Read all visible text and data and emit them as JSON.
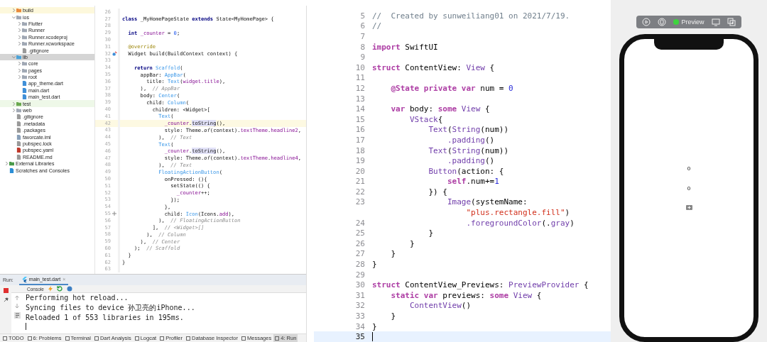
{
  "project_tree": [
    {
      "name": "build",
      "kind": "excluded",
      "expanded": false,
      "selected": false
    },
    {
      "name": "ios",
      "kind": "folder",
      "expanded": true,
      "selected": false,
      "children": [
        {
          "name": "Flutter",
          "kind": "folder",
          "expanded": false,
          "selected": false
        },
        {
          "name": "Runner",
          "kind": "folder",
          "expanded": false,
          "selected": false
        },
        {
          "name": "Runner.xcodeproj",
          "kind": "folder",
          "expanded": false,
          "selected": false
        },
        {
          "name": "Runner.xcworkspace",
          "kind": "folder",
          "expanded": false,
          "selected": false
        },
        {
          "name": ".gitignore",
          "kind": "file",
          "selected": false
        }
      ]
    },
    {
      "name": "lib",
      "kind": "source",
      "expanded": true,
      "selected": true,
      "children": [
        {
          "name": "core",
          "kind": "package",
          "expanded": false,
          "selected": false
        },
        {
          "name": "pages",
          "kind": "package",
          "expanded": false,
          "selected": false
        },
        {
          "name": "root",
          "kind": "package",
          "expanded": false,
          "selected": false
        },
        {
          "name": "app_theme.dart",
          "kind": "dart",
          "selected": false
        },
        {
          "name": "main.dart",
          "kind": "dart",
          "selected": false
        },
        {
          "name": "main_test.dart",
          "kind": "dart",
          "selected": false
        }
      ]
    },
    {
      "name": "test",
      "kind": "test",
      "expanded": false,
      "selected": false
    },
    {
      "name": "web",
      "kind": "folder",
      "expanded": false,
      "selected": false
    },
    {
      "name": ".gitignore",
      "kind": "file",
      "selected": false
    },
    {
      "name": ".metadata",
      "kind": "file",
      "selected": false
    },
    {
      "name": ".packages",
      "kind": "file",
      "selected": false
    },
    {
      "name": "favorcate.iml",
      "kind": "iml",
      "selected": false
    },
    {
      "name": "pubspec.lock",
      "kind": "file",
      "selected": false
    },
    {
      "name": "pubspec.yaml",
      "kind": "yaml",
      "selected": false
    },
    {
      "name": "README.md",
      "kind": "file",
      "selected": false
    },
    {
      "name": "External Libraries",
      "kind": "libraries",
      "expanded": false,
      "selected": false
    },
    {
      "name": "Scratches and Consoles",
      "kind": "scratches",
      "selected": false
    }
  ],
  "dart_editor": {
    "lines": [
      {
        "number": "26"
      },
      {
        "number": "27",
        "tokens": [
          {
            "text": "class ",
            "kind": "k"
          },
          {
            "text": "_MyHomePageState ",
            "kind": "p"
          },
          {
            "text": "extends ",
            "kind": "k"
          },
          {
            "text": "State<MyHomePage> {",
            "kind": "p"
          }
        ]
      },
      {
        "number": "28"
      },
      {
        "number": "29",
        "tokens": [
          {
            "text": "  int ",
            "kind": "k"
          },
          {
            "text": "_counter",
            "kind": "f"
          },
          {
            "text": " = ",
            "kind": "p"
          },
          {
            "text": "0",
            "kind": "n"
          },
          {
            "text": ";",
            "kind": "p"
          }
        ]
      },
      {
        "number": "30"
      },
      {
        "number": "31",
        "tokens": [
          {
            "text": "  @override",
            "kind": "a"
          }
        ]
      },
      {
        "number": "32",
        "kind": "override",
        "tokens": [
          {
            "text": "  Widget build(BuildContext context) {",
            "kind": "p"
          }
        ]
      },
      {
        "number": "33"
      },
      {
        "number": "34",
        "tokens": [
          {
            "text": "    return ",
            "kind": "k"
          },
          {
            "text": "Scaffold",
            "kind": "c"
          },
          {
            "text": "(",
            "kind": "p"
          }
        ]
      },
      {
        "number": "35",
        "tokens": [
          {
            "text": "      appBar: ",
            "kind": "p"
          },
          {
            "text": "AppBar",
            "kind": "c"
          },
          {
            "text": "(",
            "kind": "p"
          }
        ]
      },
      {
        "number": "36",
        "tokens": [
          {
            "text": "        title: ",
            "kind": "p"
          },
          {
            "text": "Text",
            "kind": "c"
          },
          {
            "text": "(",
            "kind": "p"
          },
          {
            "text": "widget.title",
            "kind": "f"
          },
          {
            "text": "),",
            "kind": "p"
          }
        ]
      },
      {
        "number": "37",
        "tokens": [
          {
            "text": "      ),  ",
            "kind": "p"
          },
          {
            "text": "// AppBar",
            "kind": "m"
          }
        ]
      },
      {
        "number": "38",
        "tokens": [
          {
            "text": "      body: ",
            "kind": "p"
          },
          {
            "text": "Center",
            "kind": "c"
          },
          {
            "text": "(",
            "kind": "p"
          }
        ]
      },
      {
        "number": "39",
        "tokens": [
          {
            "text": "        child: ",
            "kind": "p"
          },
          {
            "text": "Column",
            "kind": "c"
          },
          {
            "text": "(",
            "kind": "p"
          }
        ]
      },
      {
        "number": "40",
        "tokens": [
          {
            "text": "          children: <Widget>[",
            "kind": "p"
          }
        ]
      },
      {
        "number": "41",
        "tokens": [
          {
            "text": "            Text",
            "kind": "c"
          },
          {
            "text": "(",
            "kind": "p"
          }
        ]
      },
      {
        "number": "42",
        "current": true,
        "tokens": [
          {
            "text": "              _counter",
            "kind": "f"
          },
          {
            "text": ".",
            "kind": "p"
          },
          {
            "text": "toString",
            "kind": "h"
          },
          {
            "text": "(),",
            "kind": "p"
          }
        ]
      },
      {
        "number": "43",
        "tokens": [
          {
            "text": "              style: Theme.",
            "kind": "p"
          },
          {
            "text": "of",
            "kind": "i"
          },
          {
            "text": "(context).",
            "kind": "p"
          },
          {
            "text": "textTheme",
            "kind": "f"
          },
          {
            "text": ".",
            "kind": "p"
          },
          {
            "text": "headline2",
            "kind": "f"
          },
          {
            "text": ",",
            "kind": "p"
          }
        ]
      },
      {
        "number": "44",
        "tokens": [
          {
            "text": "            ),  ",
            "kind": "p"
          },
          {
            "text": "// Text",
            "kind": "m"
          }
        ]
      },
      {
        "number": "45",
        "tokens": [
          {
            "text": "            Text",
            "kind": "c"
          },
          {
            "text": "(",
            "kind": "p"
          }
        ]
      },
      {
        "number": "46",
        "tokens": [
          {
            "text": "              _counter",
            "kind": "f"
          },
          {
            "text": ".",
            "kind": "p"
          },
          {
            "text": "toString",
            "kind": "h"
          },
          {
            "text": "(),",
            "kind": "p"
          }
        ]
      },
      {
        "number": "47",
        "tokens": [
          {
            "text": "              style: Theme.",
            "kind": "p"
          },
          {
            "text": "of",
            "kind": "i"
          },
          {
            "text": "(context).",
            "kind": "p"
          },
          {
            "text": "textTheme",
            "kind": "f"
          },
          {
            "text": ".",
            "kind": "p"
          },
          {
            "text": "headline4",
            "kind": "f"
          },
          {
            "text": ",",
            "kind": "p"
          }
        ]
      },
      {
        "number": "48",
        "tokens": [
          {
            "text": "            ),  ",
            "kind": "p"
          },
          {
            "text": "// Text",
            "kind": "m"
          }
        ]
      },
      {
        "number": "49",
        "tokens": [
          {
            "text": "            FloatingActionButton",
            "kind": "c"
          },
          {
            "text": "(",
            "kind": "p"
          }
        ]
      },
      {
        "number": "50",
        "tokens": [
          {
            "text": "              onPressed: (){",
            "kind": "p"
          }
        ]
      },
      {
        "number": "51",
        "tokens": [
          {
            "text": "                setState(() {",
            "kind": "p"
          }
        ]
      },
      {
        "number": "52",
        "tokens": [
          {
            "text": "                  _counter",
            "kind": "f"
          },
          {
            "text": "++;",
            "kind": "p"
          }
        ]
      },
      {
        "number": "53",
        "tokens": [
          {
            "text": "                });",
            "kind": "p"
          }
        ]
      },
      {
        "number": "54",
        "tokens": [
          {
            "text": "              },",
            "kind": "p"
          }
        ]
      },
      {
        "number": "55",
        "kind": "add",
        "tokens": [
          {
            "text": "              child: ",
            "kind": "p"
          },
          {
            "text": "Icon",
            "kind": "c"
          },
          {
            "text": "(Icons.",
            "kind": "p"
          },
          {
            "text": "add",
            "kind": "f"
          },
          {
            "text": "),",
            "kind": "p"
          }
        ]
      },
      {
        "number": "56",
        "tokens": [
          {
            "text": "            ),  ",
            "kind": "p"
          },
          {
            "text": "// FloatingActionButton",
            "kind": "m"
          }
        ]
      },
      {
        "number": "57",
        "tokens": [
          {
            "text": "          ],  ",
            "kind": "p"
          },
          {
            "text": "// <Widget>[]",
            "kind": "m"
          }
        ]
      },
      {
        "number": "58",
        "tokens": [
          {
            "text": "        ),  ",
            "kind": "p"
          },
          {
            "text": "// Column",
            "kind": "m"
          }
        ]
      },
      {
        "number": "59",
        "tokens": [
          {
            "text": "      ),  ",
            "kind": "p"
          },
          {
            "text": "// Center",
            "kind": "m"
          }
        ]
      },
      {
        "number": "60",
        "tokens": [
          {
            "text": "    );  ",
            "kind": "p"
          },
          {
            "text": "// Scaffold",
            "kind": "m"
          }
        ]
      },
      {
        "number": "61",
        "tokens": [
          {
            "text": "  }",
            "kind": "p"
          }
        ]
      },
      {
        "number": "62",
        "tokens": [
          {
            "text": "}",
            "kind": "p"
          }
        ]
      },
      {
        "number": "63"
      }
    ]
  },
  "run_panel": {
    "label": "Run:",
    "tab": {
      "label": "main_test.dart",
      "close": "×"
    },
    "console_tab": "Console",
    "lines": [
      "Performing hot reload...",
      "Syncing files to device 孙卫亮的iPhone...",
      "Reloaded 1 of 553 libraries in 195ms."
    ]
  },
  "tool_windows": [
    {
      "label": "TODO",
      "selected": false
    },
    {
      "label": "6: Problems",
      "selected": false
    },
    {
      "label": "Terminal",
      "selected": false
    },
    {
      "label": "Dart Analysis",
      "selected": false
    },
    {
      "label": "Logcat",
      "selected": false
    },
    {
      "label": "Profiler",
      "selected": false
    },
    {
      "label": "Database Inspector",
      "selected": false
    },
    {
      "label": "Messages",
      "selected": false
    },
    {
      "label": "4: Run",
      "selected": true
    }
  ],
  "swift_editor": {
    "lines": [
      {
        "number": "5",
        "tokens": [
          {
            "text": "//  Created by sunweiliang01 on 2021/7/19.",
            "kind": "m"
          }
        ]
      },
      {
        "number": "6",
        "tokens": [
          {
            "text": "//",
            "kind": "m"
          }
        ]
      },
      {
        "number": "7"
      },
      {
        "number": "8",
        "tokens": [
          {
            "text": "import ",
            "kind": "k"
          },
          {
            "text": "SwiftUI",
            "kind": "p"
          }
        ]
      },
      {
        "number": "9"
      },
      {
        "number": "10",
        "tokens": [
          {
            "text": "struct ",
            "kind": "k"
          },
          {
            "text": "ContentView: ",
            "kind": "p"
          },
          {
            "text": "View",
            "kind": "t"
          },
          {
            "text": " {",
            "kind": "p"
          }
        ]
      },
      {
        "number": "11"
      },
      {
        "number": "12",
        "tokens": [
          {
            "text": "    @State private var ",
            "kind": "k"
          },
          {
            "text": "num = ",
            "kind": "p"
          },
          {
            "text": "0",
            "kind": "n"
          }
        ]
      },
      {
        "number": "13"
      },
      {
        "number": "14",
        "tokens": [
          {
            "text": "    var ",
            "kind": "k"
          },
          {
            "text": "body: ",
            "kind": "p"
          },
          {
            "text": "some ",
            "kind": "k"
          },
          {
            "text": "View",
            "kind": "t"
          },
          {
            "text": " {",
            "kind": "p"
          }
        ]
      },
      {
        "number": "15",
        "tokens": [
          {
            "text": "        VStack",
            "kind": "t"
          },
          {
            "text": "{",
            "kind": "p"
          }
        ]
      },
      {
        "number": "16",
        "tokens": [
          {
            "text": "            Text",
            "kind": "t"
          },
          {
            "text": "(",
            "kind": "p"
          },
          {
            "text": "String",
            "kind": "t"
          },
          {
            "text": "(num))",
            "kind": "p"
          }
        ]
      },
      {
        "number": "17",
        "tokens": [
          {
            "text": "                .padding",
            "kind": "t"
          },
          {
            "text": "()",
            "kind": "p"
          }
        ]
      },
      {
        "number": "18",
        "tokens": [
          {
            "text": "            Text",
            "kind": "t"
          },
          {
            "text": "(",
            "kind": "p"
          },
          {
            "text": "String",
            "kind": "t"
          },
          {
            "text": "(num))",
            "kind": "p"
          }
        ]
      },
      {
        "number": "19",
        "tokens": [
          {
            "text": "                .padding",
            "kind": "t"
          },
          {
            "text": "()",
            "kind": "p"
          }
        ]
      },
      {
        "number": "20",
        "tokens": [
          {
            "text": "            Button",
            "kind": "t"
          },
          {
            "text": "(action: {",
            "kind": "p"
          }
        ]
      },
      {
        "number": "21",
        "tokens": [
          {
            "text": "                self",
            "kind": "k"
          },
          {
            "text": ".num+=",
            "kind": "p"
          },
          {
            "text": "1",
            "kind": "n"
          }
        ]
      },
      {
        "number": "22",
        "tokens": [
          {
            "text": "            }) {",
            "kind": "p"
          }
        ]
      },
      {
        "number": "23",
        "tokens": [
          {
            "text": "                Image",
            "kind": "t"
          },
          {
            "text": "(systemName:",
            "kind": "p"
          }
        ]
      },
      {
        "tokens": [
          {
            "text": "                    \"plus.rectangle.fill\"",
            "kind": "s"
          },
          {
            "text": ")",
            "kind": "p"
          }
        ]
      },
      {
        "number": "24",
        "tokens": [
          {
            "text": "                    .foregroundColor",
            "kind": "t"
          },
          {
            "text": "(.",
            "kind": "p"
          },
          {
            "text": "gray",
            "kind": "t"
          },
          {
            "text": ")",
            "kind": "p"
          }
        ]
      },
      {
        "number": "25",
        "tokens": [
          {
            "text": "            }",
            "kind": "p"
          }
        ]
      },
      {
        "number": "26",
        "tokens": [
          {
            "text": "        }",
            "kind": "p"
          }
        ]
      },
      {
        "number": "27",
        "tokens": [
          {
            "text": "    }",
            "kind": "p"
          }
        ]
      },
      {
        "number": "28",
        "tokens": [
          {
            "text": "}",
            "kind": "p"
          }
        ]
      },
      {
        "number": "29"
      },
      {
        "number": "30",
        "tokens": [
          {
            "text": "struct ",
            "kind": "k"
          },
          {
            "text": "ContentView_Previews: ",
            "kind": "p"
          },
          {
            "text": "PreviewProvider",
            "kind": "t"
          },
          {
            "text": " {",
            "kind": "p"
          }
        ]
      },
      {
        "number": "31",
        "tokens": [
          {
            "text": "    static var ",
            "kind": "k"
          },
          {
            "text": "previews: ",
            "kind": "p"
          },
          {
            "text": "some ",
            "kind": "k"
          },
          {
            "text": "View",
            "kind": "t"
          },
          {
            "text": " {",
            "kind": "p"
          }
        ]
      },
      {
        "number": "32",
        "tokens": [
          {
            "text": "        ContentView",
            "kind": "t"
          },
          {
            "text": "()",
            "kind": "p"
          }
        ]
      },
      {
        "number": "33",
        "tokens": [
          {
            "text": "    }",
            "kind": "p"
          }
        ]
      },
      {
        "number": "34",
        "tokens": [
          {
            "text": "}",
            "kind": "p"
          }
        ]
      },
      {
        "number": "35",
        "current": true
      }
    ]
  },
  "preview": {
    "label": "Preview",
    "screen_texts": [
      "0",
      "0"
    ]
  }
}
